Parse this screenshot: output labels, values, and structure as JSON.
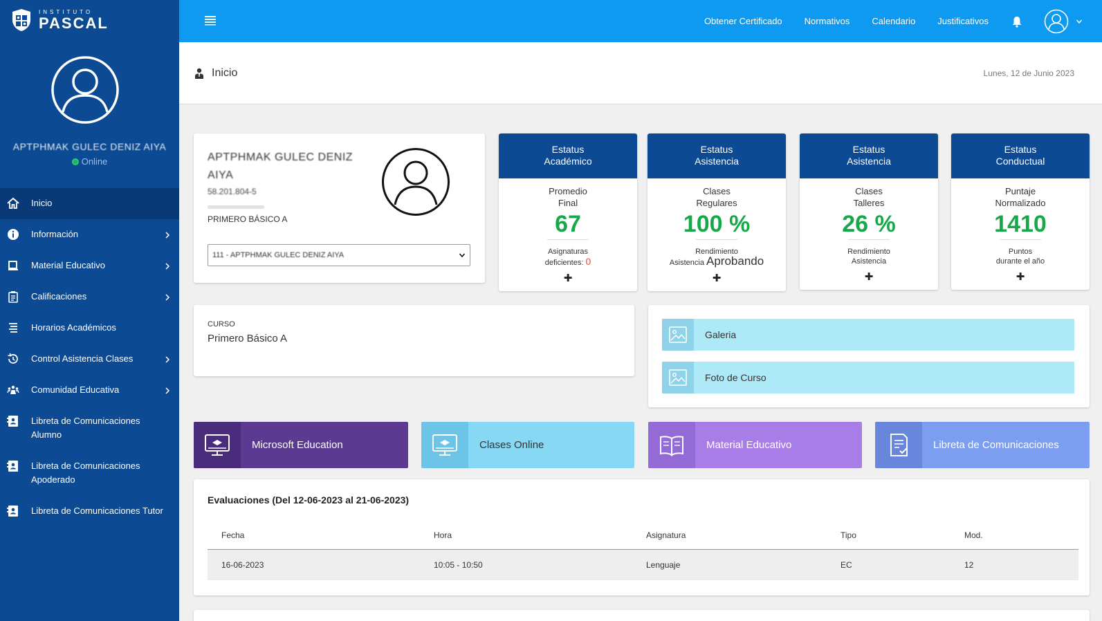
{
  "brand": {
    "small": "INSTITUTO",
    "name": "PASCAL"
  },
  "sidebar": {
    "user_name": "APTPHMAK GULEC DENIZ AIYA",
    "status": "Online",
    "items": [
      {
        "label": "Inicio",
        "icon": "home-icon",
        "chevron": false
      },
      {
        "label": "Información",
        "icon": "info-icon",
        "chevron": true
      },
      {
        "label": "Material Educativo",
        "icon": "book-icon",
        "chevron": true
      },
      {
        "label": "Calificaciones",
        "icon": "clipboard-icon",
        "chevron": true
      },
      {
        "label": "Horarios Académicos",
        "icon": "list-icon",
        "chevron": false
      },
      {
        "label": "Control Asistencia Clases",
        "icon": "history-icon",
        "chevron": true
      },
      {
        "label": "Comunidad Educativa",
        "icon": "community-icon",
        "chevron": true
      },
      {
        "label": "Libreta de Comunicaciones Alumno",
        "icon": "address-book-icon",
        "chevron": false
      },
      {
        "label": "Libreta de Comunicaciones Apoderado",
        "icon": "address-book-icon",
        "chevron": false
      },
      {
        "label": "Libreta de Comunicaciones Tutor",
        "icon": "address-book-icon",
        "chevron": false
      }
    ]
  },
  "topbar": {
    "links": [
      "Obtener Certificado",
      "Normativos",
      "Calendario",
      "Justificativos"
    ]
  },
  "page": {
    "title": "Inicio",
    "date": "Lunes, 12 de Junio 2023"
  },
  "student": {
    "name": "APTPHMAK GULEC DENIZ AIYA",
    "rut": "58.201.804-5",
    "grade": "PRIMERO BÁSICO A",
    "select_value": "111 - APTPHMAK GULEC DENIZ AIYA"
  },
  "stats": [
    {
      "head1": "Estatus",
      "head2": "Académico",
      "sub1": "Promedio",
      "sub2": "Final",
      "value": "67",
      "foot1": "Asignaturas",
      "foot2": "deficientes:",
      "foot2_extra": "0"
    },
    {
      "head1": "Estatus",
      "head2": "Asistencia",
      "sub1": "Clases",
      "sub2": "Regulares",
      "value": "100 %",
      "foot1": "Rendimiento",
      "foot2": "Asistencia",
      "foot2_extra": "Aprobando"
    },
    {
      "head1": "Estatus",
      "head2": "Asistencia",
      "sub1": "Clases",
      "sub2": "Talleres",
      "value": "26 %",
      "foot1": "Rendimiento",
      "foot2": "Asistencia",
      "foot2_extra": ""
    },
    {
      "head1": "Estatus",
      "head2": "Conductual",
      "sub1": "Puntaje",
      "sub2": "Normalizado",
      "value": "1410",
      "foot1": "Puntos",
      "foot2": "durante el año",
      "foot2_extra": ""
    }
  ],
  "curso": {
    "label": "CURSO",
    "value": "Primero Básico A"
  },
  "gallery": {
    "galeria": "Galeria",
    "foto": "Foto de Curso"
  },
  "tiles": [
    {
      "label": "Microsoft Education",
      "icon": "monitor-icon",
      "color": "#5c3a92",
      "icon_bg": "#4a2c7d"
    },
    {
      "label": "Clases Online",
      "icon": "monitor-icon",
      "color": "#87d8f5",
      "icon_bg": "#6cc4e6"
    },
    {
      "label": "Material Educativo",
      "icon": "open-book-icon",
      "color": "#a97de8",
      "icon_bg": "#936ad6"
    },
    {
      "label": "Libreta de Comunicaciones",
      "icon": "document-check-icon",
      "color": "#7b9ef0",
      "icon_bg": "#6887dc"
    }
  ],
  "evaluaciones": {
    "title": "Evaluaciones (Del 12-06-2023 al 21-06-2023)",
    "headers": [
      "Fecha",
      "Hora",
      "Asignatura",
      "Tipo",
      "Mod."
    ],
    "rows": [
      [
        "16-06-2023",
        "10:05 - 10:50",
        "Lenguaje",
        "EC",
        "12"
      ]
    ]
  }
}
